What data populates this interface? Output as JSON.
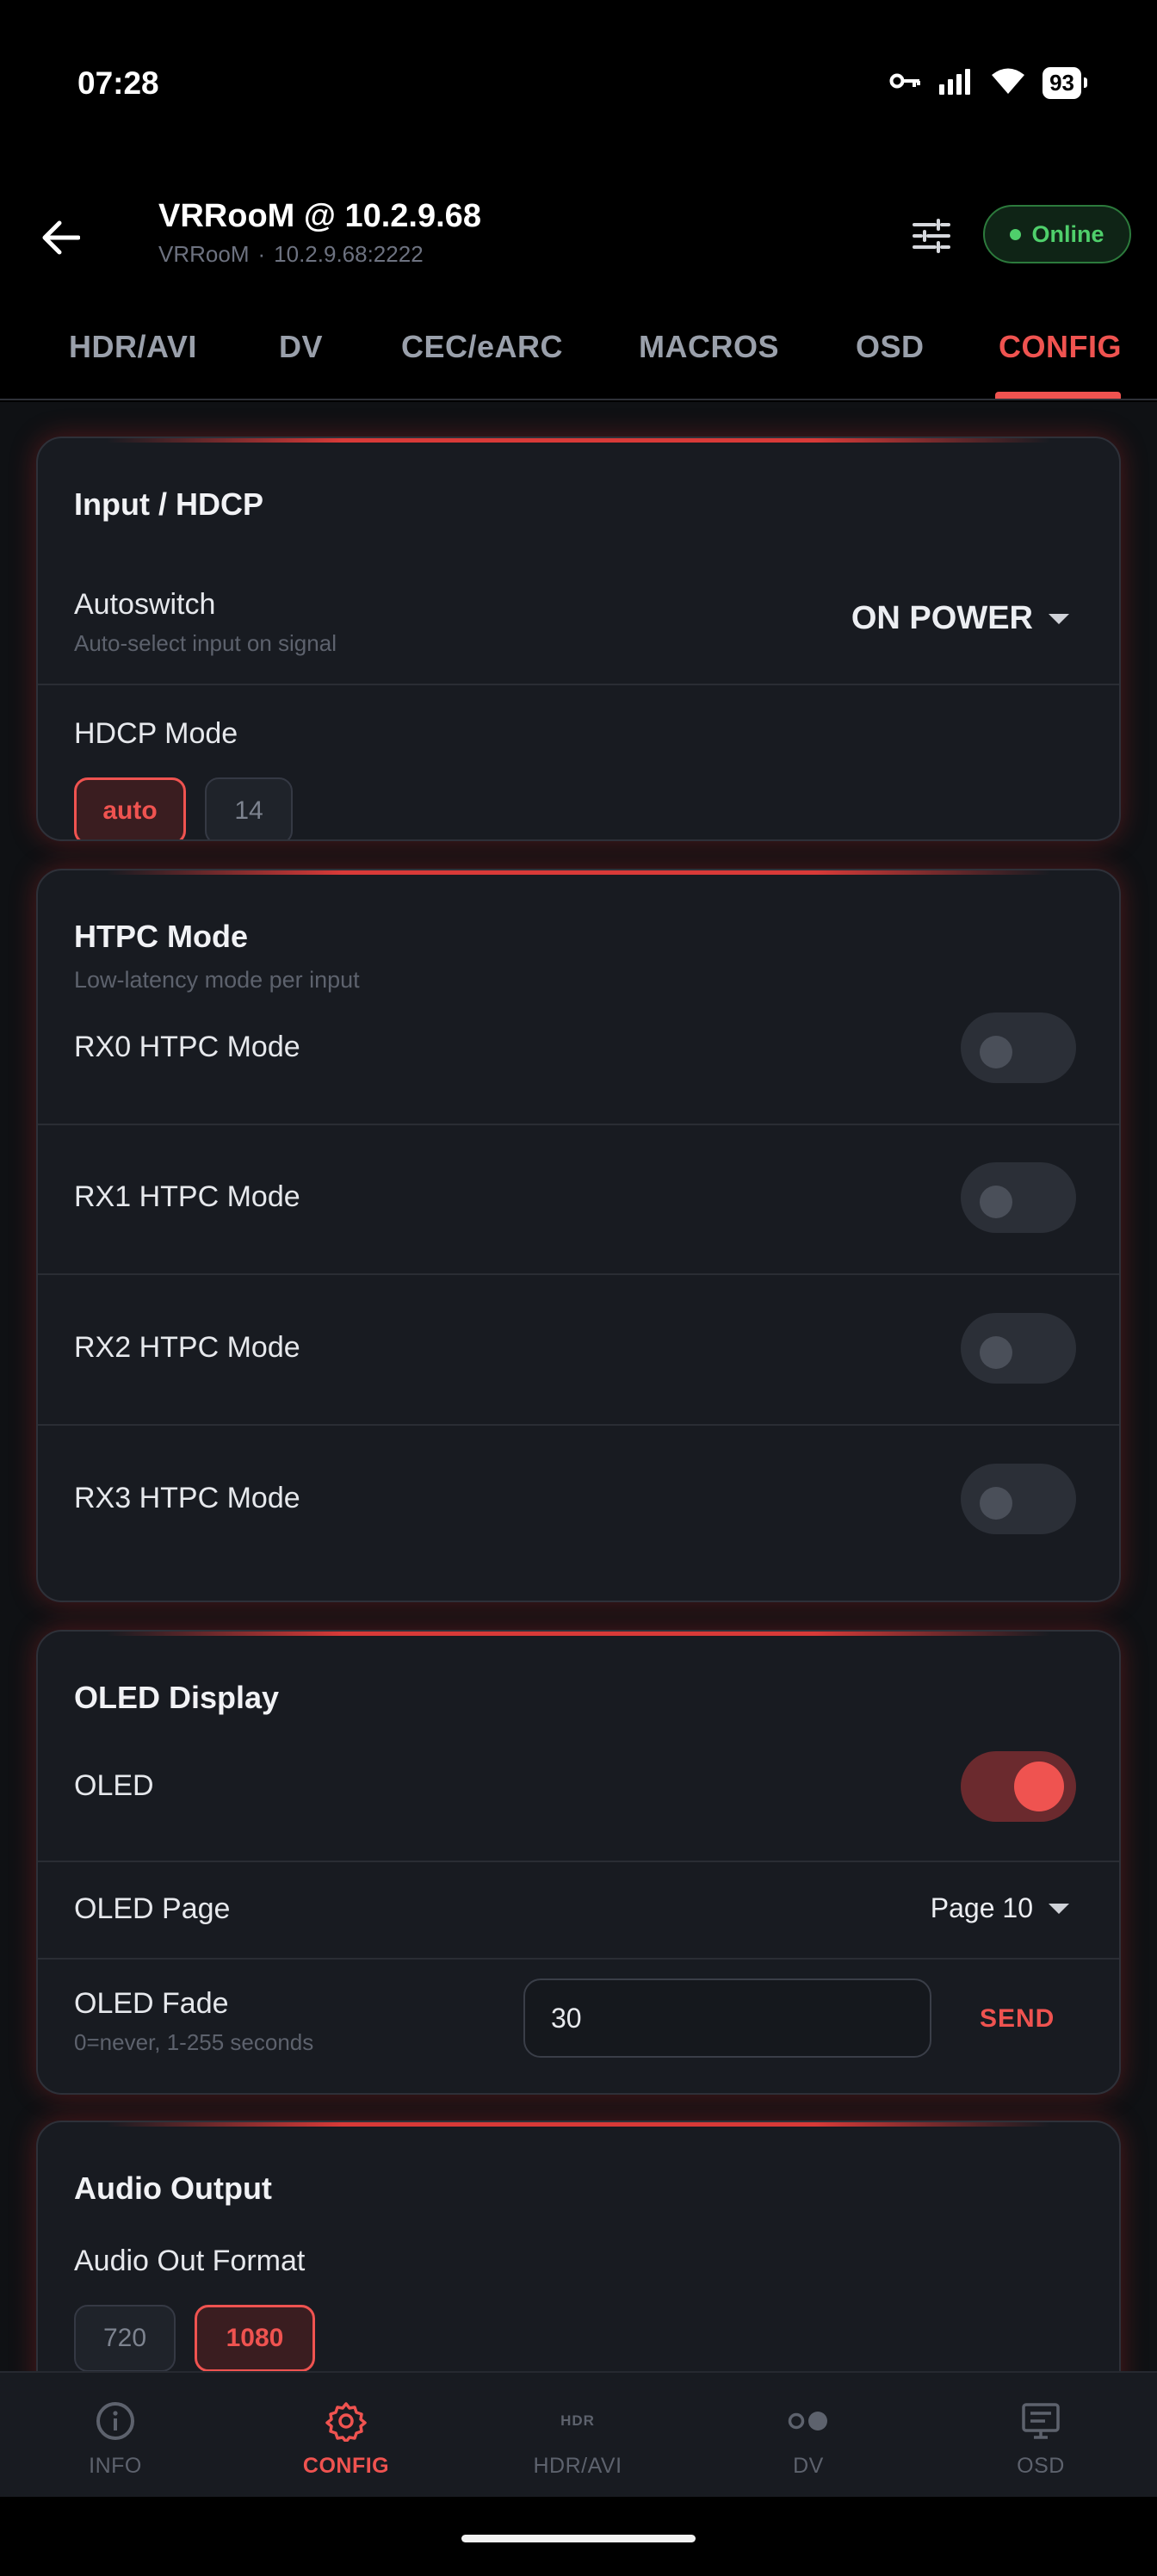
{
  "status_bar": {
    "time": "07:28",
    "battery": "93"
  },
  "header": {
    "title": "VRRooM @ 10.2.9.68",
    "subtitle_device": "VRRooM",
    "subtitle_sep": "·",
    "subtitle_addr": "10.2.9.68:2222",
    "status": "Online"
  },
  "tabs": [
    {
      "label": "HDR/AVI"
    },
    {
      "label": "DV"
    },
    {
      "label": "CEC/eARC"
    },
    {
      "label": "MACROS"
    },
    {
      "label": "OSD"
    },
    {
      "label": "CONFIG",
      "active": true
    }
  ],
  "cards": {
    "input_hdcp": {
      "title": "Input / HDCP",
      "autoswitch_label": "Autoswitch",
      "autoswitch_hint": "Auto-select input on signal",
      "autoswitch_value": "ON POWER",
      "hdcp_label": "HDCP Mode",
      "hdcp_options": [
        "auto",
        "14"
      ],
      "hdcp_selected": "auto"
    },
    "htpc": {
      "title": "HTPC Mode",
      "subtitle": "Low-latency mode per input",
      "rows": [
        {
          "label": "RX0 HTPC Mode",
          "on": false
        },
        {
          "label": "RX1 HTPC Mode",
          "on": false
        },
        {
          "label": "RX2 HTPC Mode",
          "on": false
        },
        {
          "label": "RX3 HTPC Mode",
          "on": false
        }
      ]
    },
    "oled": {
      "title": "OLED Display",
      "oled_label": "OLED",
      "oled_on": true,
      "page_label": "OLED Page",
      "page_value": "Page 10",
      "fade_label": "OLED Fade",
      "fade_hint": "0=never, 1-255 seconds",
      "fade_value": "30",
      "send_label": "SEND"
    },
    "audio": {
      "title": "Audio Output",
      "format_label": "Audio Out Format",
      "format_options": [
        "720",
        "1080"
      ],
      "format_selected": "1080"
    }
  },
  "bottom_nav": [
    {
      "label": "INFO",
      "icon": "info-icon"
    },
    {
      "label": "CONFIG",
      "icon": "gear-icon",
      "active": true
    },
    {
      "label": "HDR/AVI",
      "icon": "hdr-icon",
      "icon_text": "HDR"
    },
    {
      "label": "DV",
      "icon": "dv-icon"
    },
    {
      "label": "OSD",
      "icon": "osd-icon"
    }
  ],
  "colors": {
    "accent": "#ef5350",
    "online": "#4fcf6b",
    "card_bg": "#181b21",
    "page_bg": "#0f1114"
  }
}
